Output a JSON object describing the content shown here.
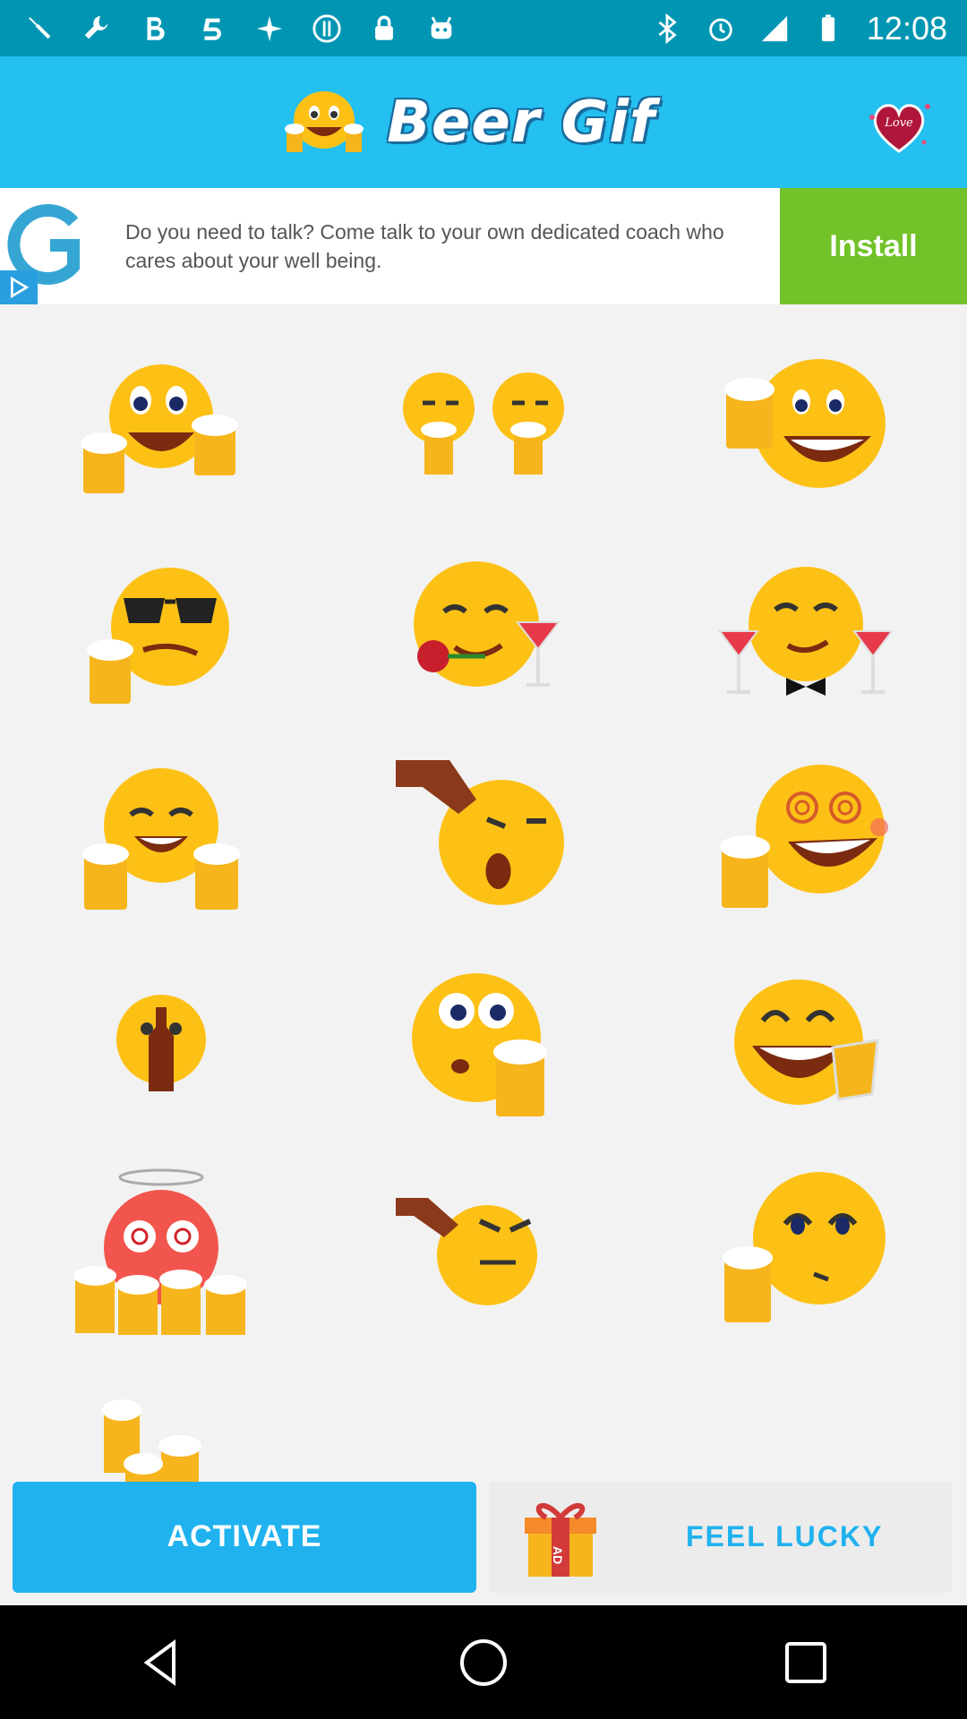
{
  "status_bar": {
    "time": "12:08",
    "left_icons": [
      "wrench-icon",
      "bold-b-icon",
      "app-5-icon",
      "fake-gps-icon",
      "info-icon",
      "lock-icon",
      "android-icon"
    ],
    "right_icons": [
      "bluetooth-icon",
      "alarm-icon",
      "signal-icon",
      "battery-icon"
    ]
  },
  "app_bar": {
    "title": "Beer Gif",
    "love_badge": "Love"
  },
  "ad": {
    "text": "Do you need to talk? Come talk to your own dedicated coach who cares about your well being.",
    "cta": "Install",
    "colors": {
      "cta": "#72c22a",
      "logo": "#35a6d3"
    }
  },
  "stickers": [
    {
      "name": "cheers-two-mugs"
    },
    {
      "name": "two-smileys-with-beer"
    },
    {
      "name": "laughing-with-mug"
    },
    {
      "name": "sunglasses-beer"
    },
    {
      "name": "rose-cocktail"
    },
    {
      "name": "bowtie-cocktails"
    },
    {
      "name": "happy-two-mugs"
    },
    {
      "name": "bottle-pour-sad"
    },
    {
      "name": "dizzy-beer"
    },
    {
      "name": "bottle-in-mouth"
    },
    {
      "name": "surprised-mug"
    },
    {
      "name": "grinning-glass"
    },
    {
      "name": "drunk-red-spiral"
    },
    {
      "name": "bottle-pour-angry"
    },
    {
      "name": "smirk-mug"
    },
    {
      "name": "beer-mugs-pile"
    }
  ],
  "bottom": {
    "activate_label": "ACTIVATE",
    "lucky_label": "FEEL LUCKY",
    "gift_badge": "AD"
  },
  "colors": {
    "status_bar": "#0096b3",
    "app_bar": "#24c0f0",
    "accent": "#1fb2ee",
    "face": "#fdc116"
  }
}
